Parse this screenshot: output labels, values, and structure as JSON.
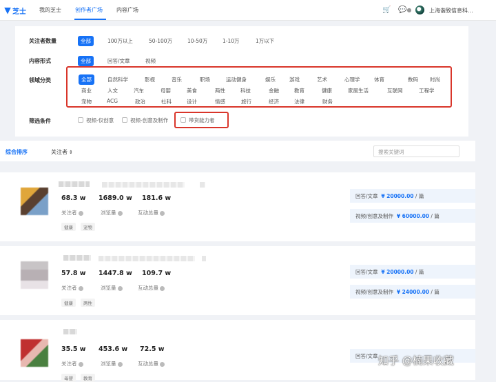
{
  "header": {
    "logo_text": "芝士",
    "nav": [
      "我的芝士",
      "创作者广场",
      "内容广场"
    ],
    "user_name": "上海谐致信息科..."
  },
  "filters": {
    "follower_label": "关注者数量",
    "follower_options": [
      "全部",
      "100万以上",
      "50-100万",
      "10-50万",
      "1-10万",
      "1万以下"
    ],
    "form_label": "内容形式",
    "form_options": [
      "全部",
      "回答/文章",
      "视频"
    ],
    "domain_label": "领域分类",
    "domain_row1": [
      "全部",
      "自然科学",
      "影视",
      "音乐",
      "职场",
      "运动健身",
      "娱乐",
      "游戏",
      "艺术",
      "心理学",
      "体育",
      "数码",
      "时尚"
    ],
    "domain_row2": [
      "商业",
      "人文",
      "汽车",
      "母婴",
      "美食",
      "两性",
      "科技",
      "金融",
      "教育",
      "健康",
      "家居生活",
      "互联网",
      "工程学"
    ],
    "domain_row3": [
      "宠物",
      "ACG",
      "政治",
      "社科",
      "设计",
      "情感",
      "旅行",
      "经济",
      "法律",
      "财务"
    ],
    "screen_label": "筛选条件",
    "screen_options": [
      "视频-仅创意",
      "视频-创意及制作",
      "带货能力者"
    ]
  },
  "sortbar": {
    "sort_all": "综合排序",
    "sort_follow": "关注者",
    "search_placeholder": "搜索关键词"
  },
  "creators": [
    {
      "followers": "68.3 w",
      "views": "1689.0 w",
      "interactions": "181.6 w",
      "followers_label": "关注者",
      "views_label": "浏览量",
      "inter_label": "互动总量",
      "tags": [
        "健康",
        "宠物"
      ],
      "price1_label": "回答/文章",
      "price1": "¥ 20000.00",
      "price1_unit": "/ 篇",
      "price2_label": "视频/创意及制作",
      "price2": "¥ 60000.00",
      "price2_unit": "/ 篇"
    },
    {
      "followers": "57.8 w",
      "views": "1447.8 w",
      "interactions": "109.7 w",
      "followers_label": "关注者",
      "views_label": "浏览量",
      "inter_label": "互动总量",
      "tags": [
        "健康",
        "两性"
      ],
      "price1_label": "回答/文章",
      "price1": "¥ 20000.00",
      "price1_unit": "/ 篇",
      "price2_label": "视频/创意及制作",
      "price2": "¥ 24000.00",
      "price2_unit": "/ 篇"
    },
    {
      "followers": "35.5 w",
      "views": "453.6 w",
      "interactions": "72.5 w",
      "followers_label": "关注者",
      "views_label": "浏览量",
      "inter_label": "互动总量",
      "tags": [
        "母婴",
        "教育"
      ],
      "price1_label": "回答/文章"
    }
  ],
  "watermark": "知乎 @楠果收藏",
  "colors": {
    "accent": "#1772f6",
    "highlight_box": "#d9352a"
  }
}
